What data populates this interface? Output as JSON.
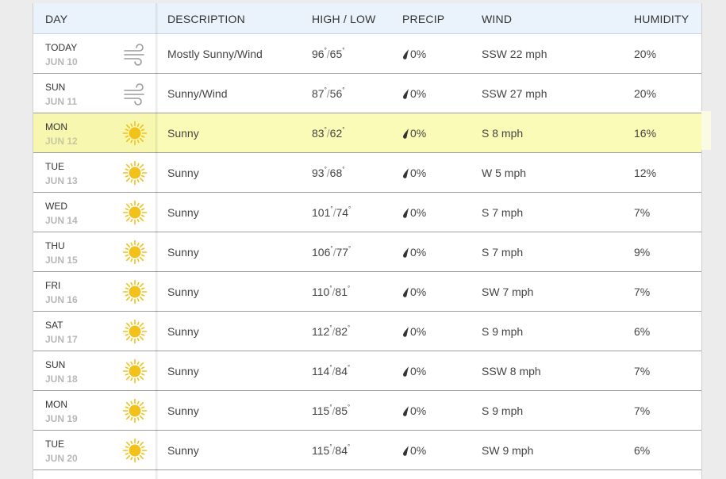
{
  "columns": {
    "day": "DAY",
    "description": "DESCRIPTION",
    "high_low": "HIGH / LOW",
    "precip": "PRECIP",
    "wind": "WIND",
    "humidity": "HUMIDITY"
  },
  "colors": {
    "highlight": "#fbfbb8",
    "sun": "#f2c21a",
    "header_bg": "#eaf3fb"
  },
  "rows": [
    {
      "day": "TODAY",
      "date": "JUN 10",
      "icon": "wind-icon",
      "desc": "Mostly Sunny/Wind",
      "high": "96",
      "low": "65",
      "precip": "0%",
      "wind": "SSW 22 mph",
      "humidity": "20%",
      "highlight": false
    },
    {
      "day": "SUN",
      "date": "JUN 11",
      "icon": "wind-icon",
      "desc": "Sunny/Wind",
      "high": "87",
      "low": "56",
      "precip": "0%",
      "wind": "SSW 27 mph",
      "humidity": "20%",
      "highlight": false
    },
    {
      "day": "MON",
      "date": "JUN 12",
      "icon": "sun-icon",
      "desc": "Sunny",
      "high": "83",
      "low": "62",
      "precip": "0%",
      "wind": "S 8 mph",
      "humidity": "16%",
      "highlight": true
    },
    {
      "day": "TUE",
      "date": "JUN 13",
      "icon": "sun-icon",
      "desc": "Sunny",
      "high": "93",
      "low": "68",
      "precip": "0%",
      "wind": "W 5 mph",
      "humidity": "12%",
      "highlight": false
    },
    {
      "day": "WED",
      "date": "JUN 14",
      "icon": "sun-icon",
      "desc": "Sunny",
      "high": "101",
      "low": "74",
      "precip": "0%",
      "wind": "S 7 mph",
      "humidity": "7%",
      "highlight": false
    },
    {
      "day": "THU",
      "date": "JUN 15",
      "icon": "sun-icon",
      "desc": "Sunny",
      "high": "106",
      "low": "77",
      "precip": "0%",
      "wind": "S 7 mph",
      "humidity": "9%",
      "highlight": false
    },
    {
      "day": "FRI",
      "date": "JUN 16",
      "icon": "sun-icon",
      "desc": "Sunny",
      "high": "110",
      "low": "81",
      "precip": "0%",
      "wind": "SW 7 mph",
      "humidity": "7%",
      "highlight": false
    },
    {
      "day": "SAT",
      "date": "JUN 17",
      "icon": "sun-icon",
      "desc": "Sunny",
      "high": "112",
      "low": "82",
      "precip": "0%",
      "wind": "S 9 mph",
      "humidity": "6%",
      "highlight": false
    },
    {
      "day": "SUN",
      "date": "JUN 18",
      "icon": "sun-icon",
      "desc": "Sunny",
      "high": "114",
      "low": "84",
      "precip": "0%",
      "wind": "SSW 8 mph",
      "humidity": "7%",
      "highlight": false
    },
    {
      "day": "MON",
      "date": "JUN 19",
      "icon": "sun-icon",
      "desc": "Sunny",
      "high": "115",
      "low": "85",
      "precip": "0%",
      "wind": "S 9 mph",
      "humidity": "7%",
      "highlight": false
    },
    {
      "day": "TUE",
      "date": "JUN 20",
      "icon": "sun-icon",
      "desc": "Sunny",
      "high": "115",
      "low": "84",
      "precip": "0%",
      "wind": "SW 9 mph",
      "humidity": "6%",
      "highlight": false
    }
  ]
}
